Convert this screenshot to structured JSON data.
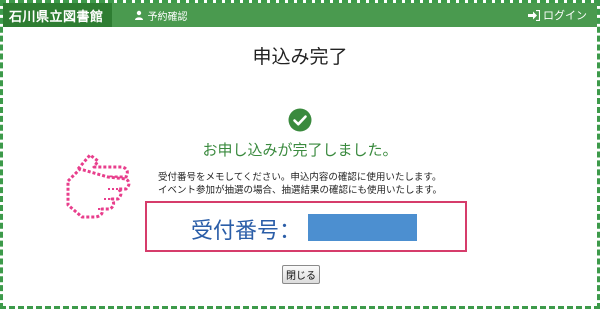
{
  "header": {
    "brand": "石川県立図書館",
    "reserve_link": "予約確認",
    "login_link": "ログイン"
  },
  "main": {
    "title": "申込み完了",
    "status_message": "お申し込みが完了しました。",
    "notes": [
      "受付番号をメモしてください。申込内容の確認に使用いたします。",
      "イベント参加が抽選の場合、抽選結果の確認にも使用いたします。"
    ],
    "reception_label": "受付番号：",
    "reception_number": "",
    "close_button": "閉じる"
  },
  "colors": {
    "header_bg": "#4a9a4f",
    "brand_bg": "#2e7d32",
    "success": "#3a8a3e",
    "highlight_border": "#d63c6b",
    "number_text": "#2b5ea8",
    "redaction": "#4c8fd0",
    "pointer_hand": "#e83e8c"
  },
  "icons": {
    "reserve": "user-icon",
    "login": "login-icon",
    "status": "check-circle-icon",
    "pointer": "pointing-hand-icon"
  }
}
